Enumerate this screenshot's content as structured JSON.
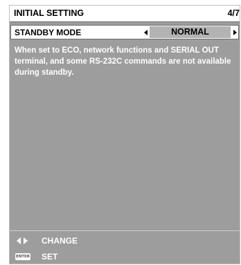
{
  "menu": {
    "title": "INITIAL SETTING",
    "page_indicator": "4/7"
  },
  "setting": {
    "label": "STANDBY MODE",
    "value": "NORMAL"
  },
  "description": "When set to ECO, network functions and SERIAL OUT terminal, and some RS-232C commands are not available during standby.",
  "footer": {
    "change_label": "CHANGE",
    "set_label": "SET",
    "enter_icon_text": "ENTER"
  },
  "icons": {
    "left_arrow": "triangle-left-icon",
    "right_arrow": "triangle-right-icon",
    "left_right": "left-right-arrows-icon",
    "enter": "enter-button-icon"
  },
  "colors": {
    "panel_background": "#9d9d9d",
    "header_background": "#ffffff",
    "value_highlight": "#b3b3b3",
    "text_light": "#ffffff",
    "text_dark": "#000000"
  }
}
